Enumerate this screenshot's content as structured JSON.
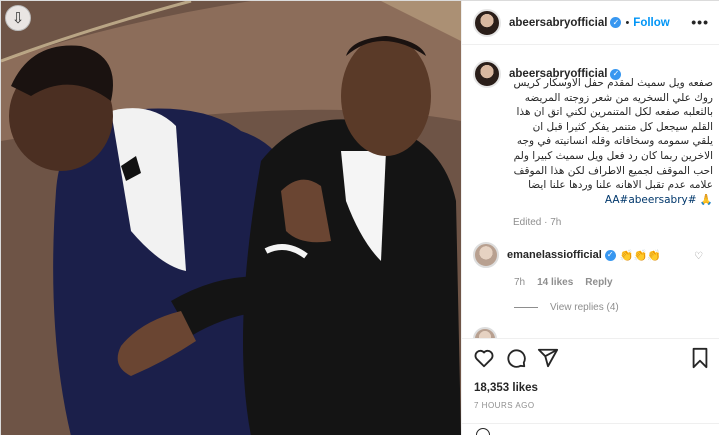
{
  "post": {
    "username": "abeersabryofficial",
    "follow_label": "Follow",
    "more_label": "•••",
    "separator": "•"
  },
  "caption": {
    "username": "abeersabryofficial",
    "text": "صفعه ويل سميث لمقدم حفل الاوسكار كريس روك علي السخريه من شعر زوجته المريضه بالثعلبه صفعه لكل المتنمرين لكني اتق ان هذا القلم سيجعل كل متنمر يفكر كثيرا قبل ان يلقي سمومه وسخافاته وقله انسانيته في وجه الاخرين ربما كان رد فعل ويل سميث كبيرا ولم احب الموقف لجميع الاطراف لكن هذا الموقف علامه عدم تقبل الاهانه علنا وردها علنا ايضا 🙏",
    "tags": "#AA#abeersabry",
    "edited": "Edited · 7h"
  },
  "comment": {
    "username": "emanelassiofficial",
    "text": "👏👏👏",
    "time": "7h",
    "likes": "14 likes",
    "reply_label": "Reply",
    "view_replies": "View replies (4)"
  },
  "stats": {
    "likes": "18,353 likes",
    "posted": "7 HOURS AGO"
  },
  "icons": {
    "download": "download-icon",
    "like": "heart-icon",
    "comment": "comment-icon",
    "share": "share-icon",
    "save": "bookmark-icon"
  },
  "colors": {
    "accent": "#0095f6",
    "verified": "#3897f0",
    "muted": "#8e8e8e",
    "text": "#262626"
  }
}
